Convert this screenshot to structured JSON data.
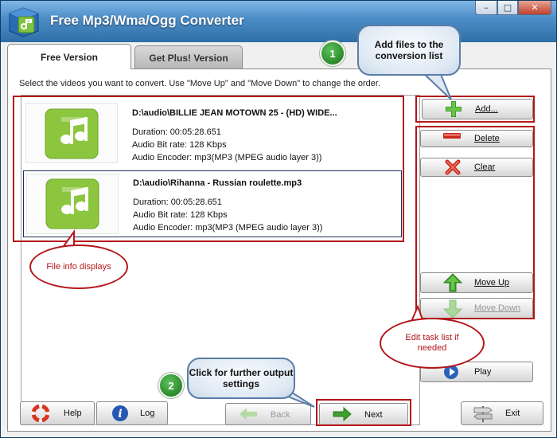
{
  "window": {
    "title": "Free Mp3/Wma/Ogg Converter",
    "min_label": "–",
    "max_label": "□",
    "close_label": "✕"
  },
  "tabs": [
    {
      "label": "Free Version",
      "active": true
    },
    {
      "label": "Get Plus! Version",
      "active": false
    }
  ],
  "instruction": "Select the videos you want to convert. Use \"Move Up\" and \"Move Down\" to change the order.",
  "files": [
    {
      "name": "D:\\audio\\BILLIE JEAN MOTOWN 25 -  (HD) WIDE...",
      "duration": "Duration: 00:05:28.651",
      "bitrate": "Audio Bit rate: 128 Kbps",
      "encoder": "Audio Encoder: mp3(MP3 (MPEG audio layer 3))",
      "icon": "music-note-icon"
    },
    {
      "name": "D:\\audio\\Rihanna - Russian roulette.mp3",
      "duration": "Duration: 00:05:28.651",
      "bitrate": "Audio Bit rate: 128 Kbps",
      "encoder": "Audio Encoder: mp3(MP3 (MPEG audio layer 3))",
      "icon": "music-note-icon",
      "selected": true
    }
  ],
  "side_buttons": {
    "add": "Add...",
    "delete": "Delete",
    "clear": "Clear",
    "move_up": "Move Up",
    "move_down": "Move Down",
    "play": "Play"
  },
  "bottom_buttons": {
    "help": "Help",
    "log": "Log",
    "back": "Back",
    "next": "Next",
    "exit": "Exit"
  },
  "callouts": {
    "add_files": "Add files to the conversion list",
    "file_info": "File info displays",
    "edit_task": "Edit task list if needed",
    "output_settings": "Click for further output settings",
    "step1": "1",
    "step2": "2"
  },
  "colors": {
    "title_blue": "#2f6fa6",
    "annotation_red": "#b3161a",
    "badge_green": "#2b8a2b",
    "icon_green": "#8cc63f"
  }
}
